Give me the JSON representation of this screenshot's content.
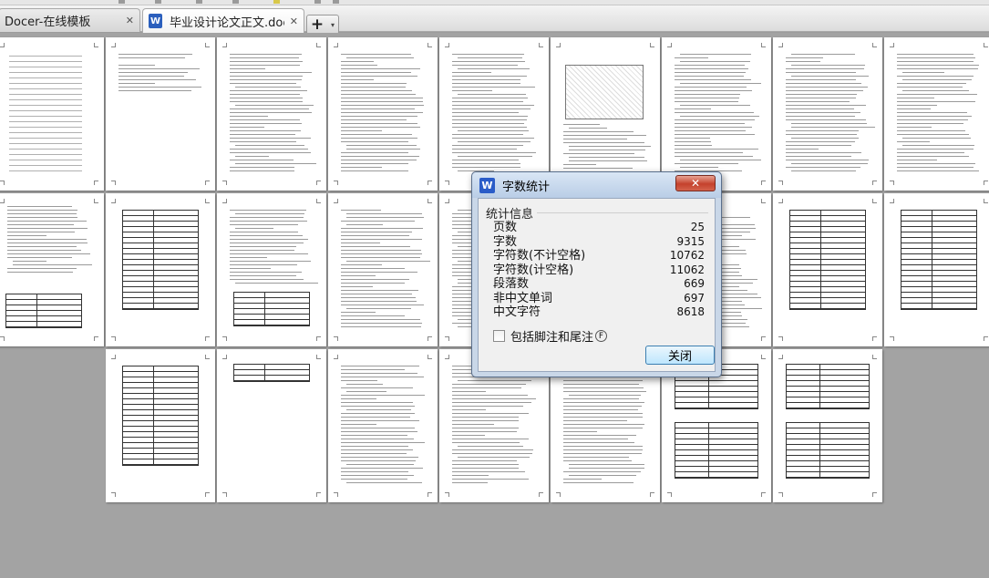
{
  "tabs": [
    {
      "label": "Docer-在线模板",
      "active": false,
      "close": "✕"
    },
    {
      "label": "毕业设计论文正文.doc",
      "active": true,
      "close": "✕",
      "icon": "W"
    }
  ],
  "new_tab": {
    "plus": "+",
    "dropdown": "▾"
  },
  "pages": {
    "row1": [
      "toc",
      "cover",
      "text",
      "text",
      "text",
      "figure",
      "text",
      "text",
      "text"
    ],
    "row2": [
      "list-table",
      "table",
      "text-table",
      "text",
      "text",
      "text",
      "text",
      "table",
      "table"
    ],
    "row3": [
      "table",
      "small-table",
      "text",
      "text",
      "text",
      "tables",
      "tables"
    ]
  },
  "dialog": {
    "icon": "W",
    "title": "字数统计",
    "close_label": "✕",
    "group_title": "统计信息",
    "stats": [
      {
        "label": "页数",
        "value": "25"
      },
      {
        "label": "字数",
        "value": "9315"
      },
      {
        "label": "字符数(不计空格)",
        "value": "10762"
      },
      {
        "label": "字符数(计空格)",
        "value": "11062"
      },
      {
        "label": "段落数",
        "value": "669"
      },
      {
        "label": "非中文单词",
        "value": "697"
      },
      {
        "label": "中文字符",
        "value": "8618"
      }
    ],
    "checkbox_label": "包括脚注和尾注",
    "checkbox_key": "F",
    "checkbox_checked": false,
    "ok_label": "关闭"
  }
}
